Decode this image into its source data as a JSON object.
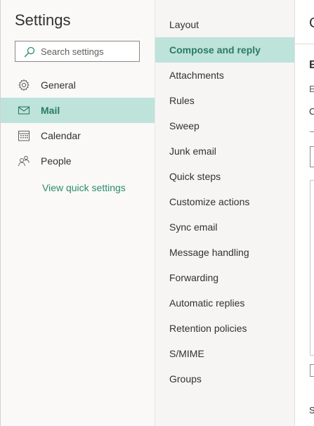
{
  "settings_panel": {
    "title": "Settings",
    "search": {
      "placeholder": "Search settings",
      "value": ""
    },
    "nav_items": [
      {
        "label": "General",
        "icon": "gear-icon",
        "selected": false
      },
      {
        "label": "Mail",
        "icon": "mail-icon",
        "selected": true
      },
      {
        "label": "Calendar",
        "icon": "calendar-icon",
        "selected": false
      },
      {
        "label": "People",
        "icon": "people-icon",
        "selected": false
      }
    ],
    "quick_settings_link": "View quick settings"
  },
  "mail_subnav": {
    "items": [
      {
        "label": "Layout",
        "selected": false
      },
      {
        "label": "Compose and reply",
        "selected": true
      },
      {
        "label": "Attachments",
        "selected": false
      },
      {
        "label": "Rules",
        "selected": false
      },
      {
        "label": "Sweep",
        "selected": false
      },
      {
        "label": "Junk email",
        "selected": false
      },
      {
        "label": "Quick steps",
        "selected": false
      },
      {
        "label": "Customize actions",
        "selected": false
      },
      {
        "label": "Sync email",
        "selected": false
      },
      {
        "label": "Message handling",
        "selected": false
      },
      {
        "label": "Forwarding",
        "selected": false
      },
      {
        "label": "Automatic replies",
        "selected": false
      },
      {
        "label": "Retention policies",
        "selected": false
      },
      {
        "label": "S/MIME",
        "selected": false
      },
      {
        "label": "Groups",
        "selected": false
      }
    ]
  },
  "content_pane": {
    "title_fragment": "C",
    "section_fragment": "E",
    "line1_fragment": "E",
    "line2_fragment": "C",
    "footer_fragment": "S"
  },
  "colors": {
    "accent_selected_bg": "#bde3db",
    "accent_text": "#2b7a61",
    "link": "#2d8a6e"
  }
}
